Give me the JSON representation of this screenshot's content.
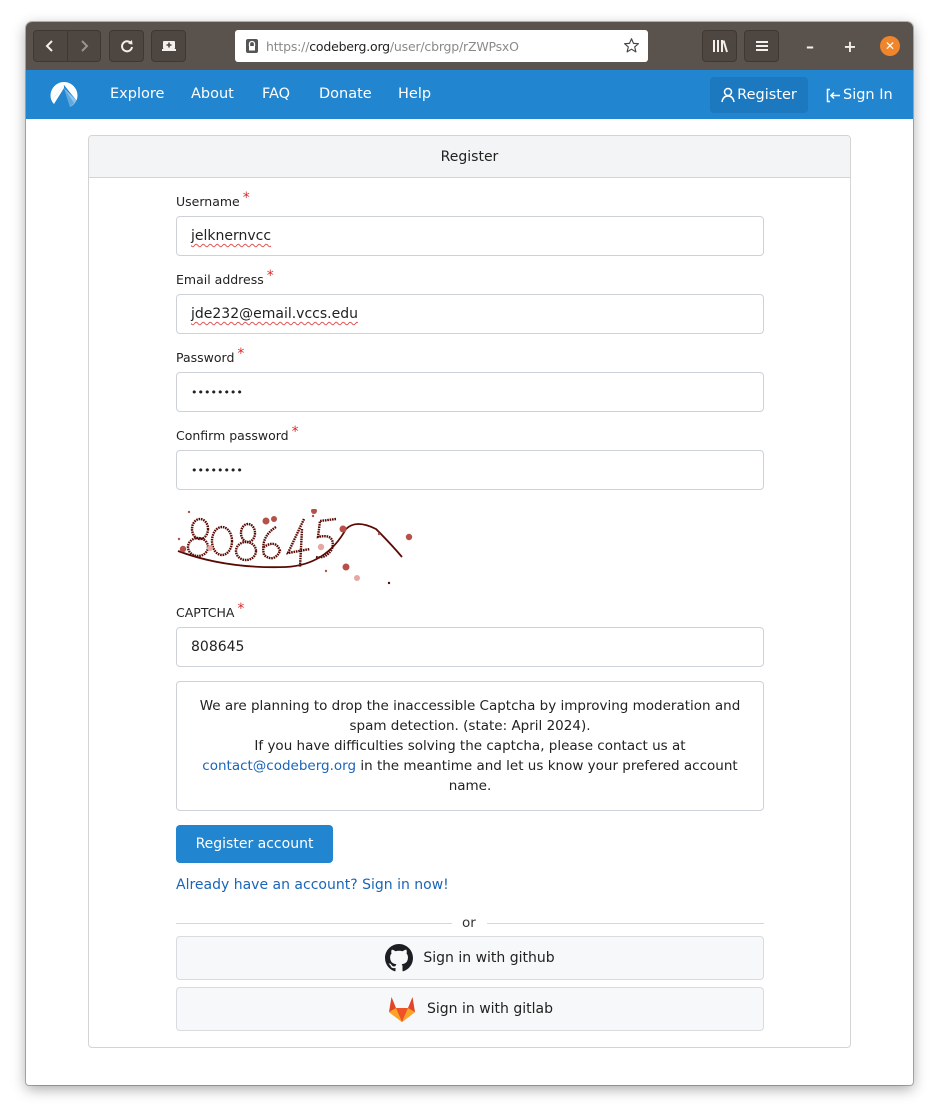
{
  "browser": {
    "url_scheme": "https://",
    "url_domain": "codeberg.org",
    "url_path": "/user/cbrgp/rZWPsxO",
    "icons": {
      "back": "chevron-left-icon",
      "forward": "chevron-right-icon",
      "reload": "reload-icon",
      "container": "container-icon",
      "lock": "lock-icon",
      "bookmark": "star-icon",
      "library": "library-icon",
      "menu": "hamburger-menu-icon",
      "minimize": "minimize-icon",
      "maximize": "maximize-icon",
      "close": "close-icon"
    },
    "window_controls": {
      "minimize": "–",
      "maximize": "+",
      "close": "✕"
    }
  },
  "site_nav": {
    "brand": "codeberg-logo",
    "links": [
      "Explore",
      "About",
      "FAQ",
      "Donate",
      "Help"
    ],
    "register_label": "Register",
    "signin_label": "Sign In",
    "accent_color": "#2185d0"
  },
  "register_form": {
    "title": "Register",
    "required_marker": "*",
    "fields": {
      "username": {
        "label": "Username",
        "value": "jelknernvcc"
      },
      "email": {
        "label": "Email address",
        "value": "jde232@email.vccs.edu"
      },
      "password": {
        "label": "Password",
        "value": "••••••••"
      },
      "confirm_password": {
        "label": "Confirm password",
        "value": "••••••••"
      },
      "captcha": {
        "label": "CAPTCHA",
        "value": "808645",
        "image_text": "808645"
      }
    },
    "notice": {
      "line1": "We are planning to drop the inaccessible Captcha by improving moderation and spam detection. (state: April 2024).",
      "line2": "If you have difficulties solving the captcha, please contact us at",
      "email_link": "contact@codeberg.org",
      "line3": "in the meantime and let us know your prefered account name."
    },
    "submit_label": "Register account",
    "signin_link": "Already have an account? Sign in now!",
    "divider_text": "or",
    "oauth": [
      {
        "label": "Sign in with github",
        "icon": "github-icon"
      },
      {
        "label": "Sign in with gitlab",
        "icon": "gitlab-icon"
      }
    ]
  }
}
